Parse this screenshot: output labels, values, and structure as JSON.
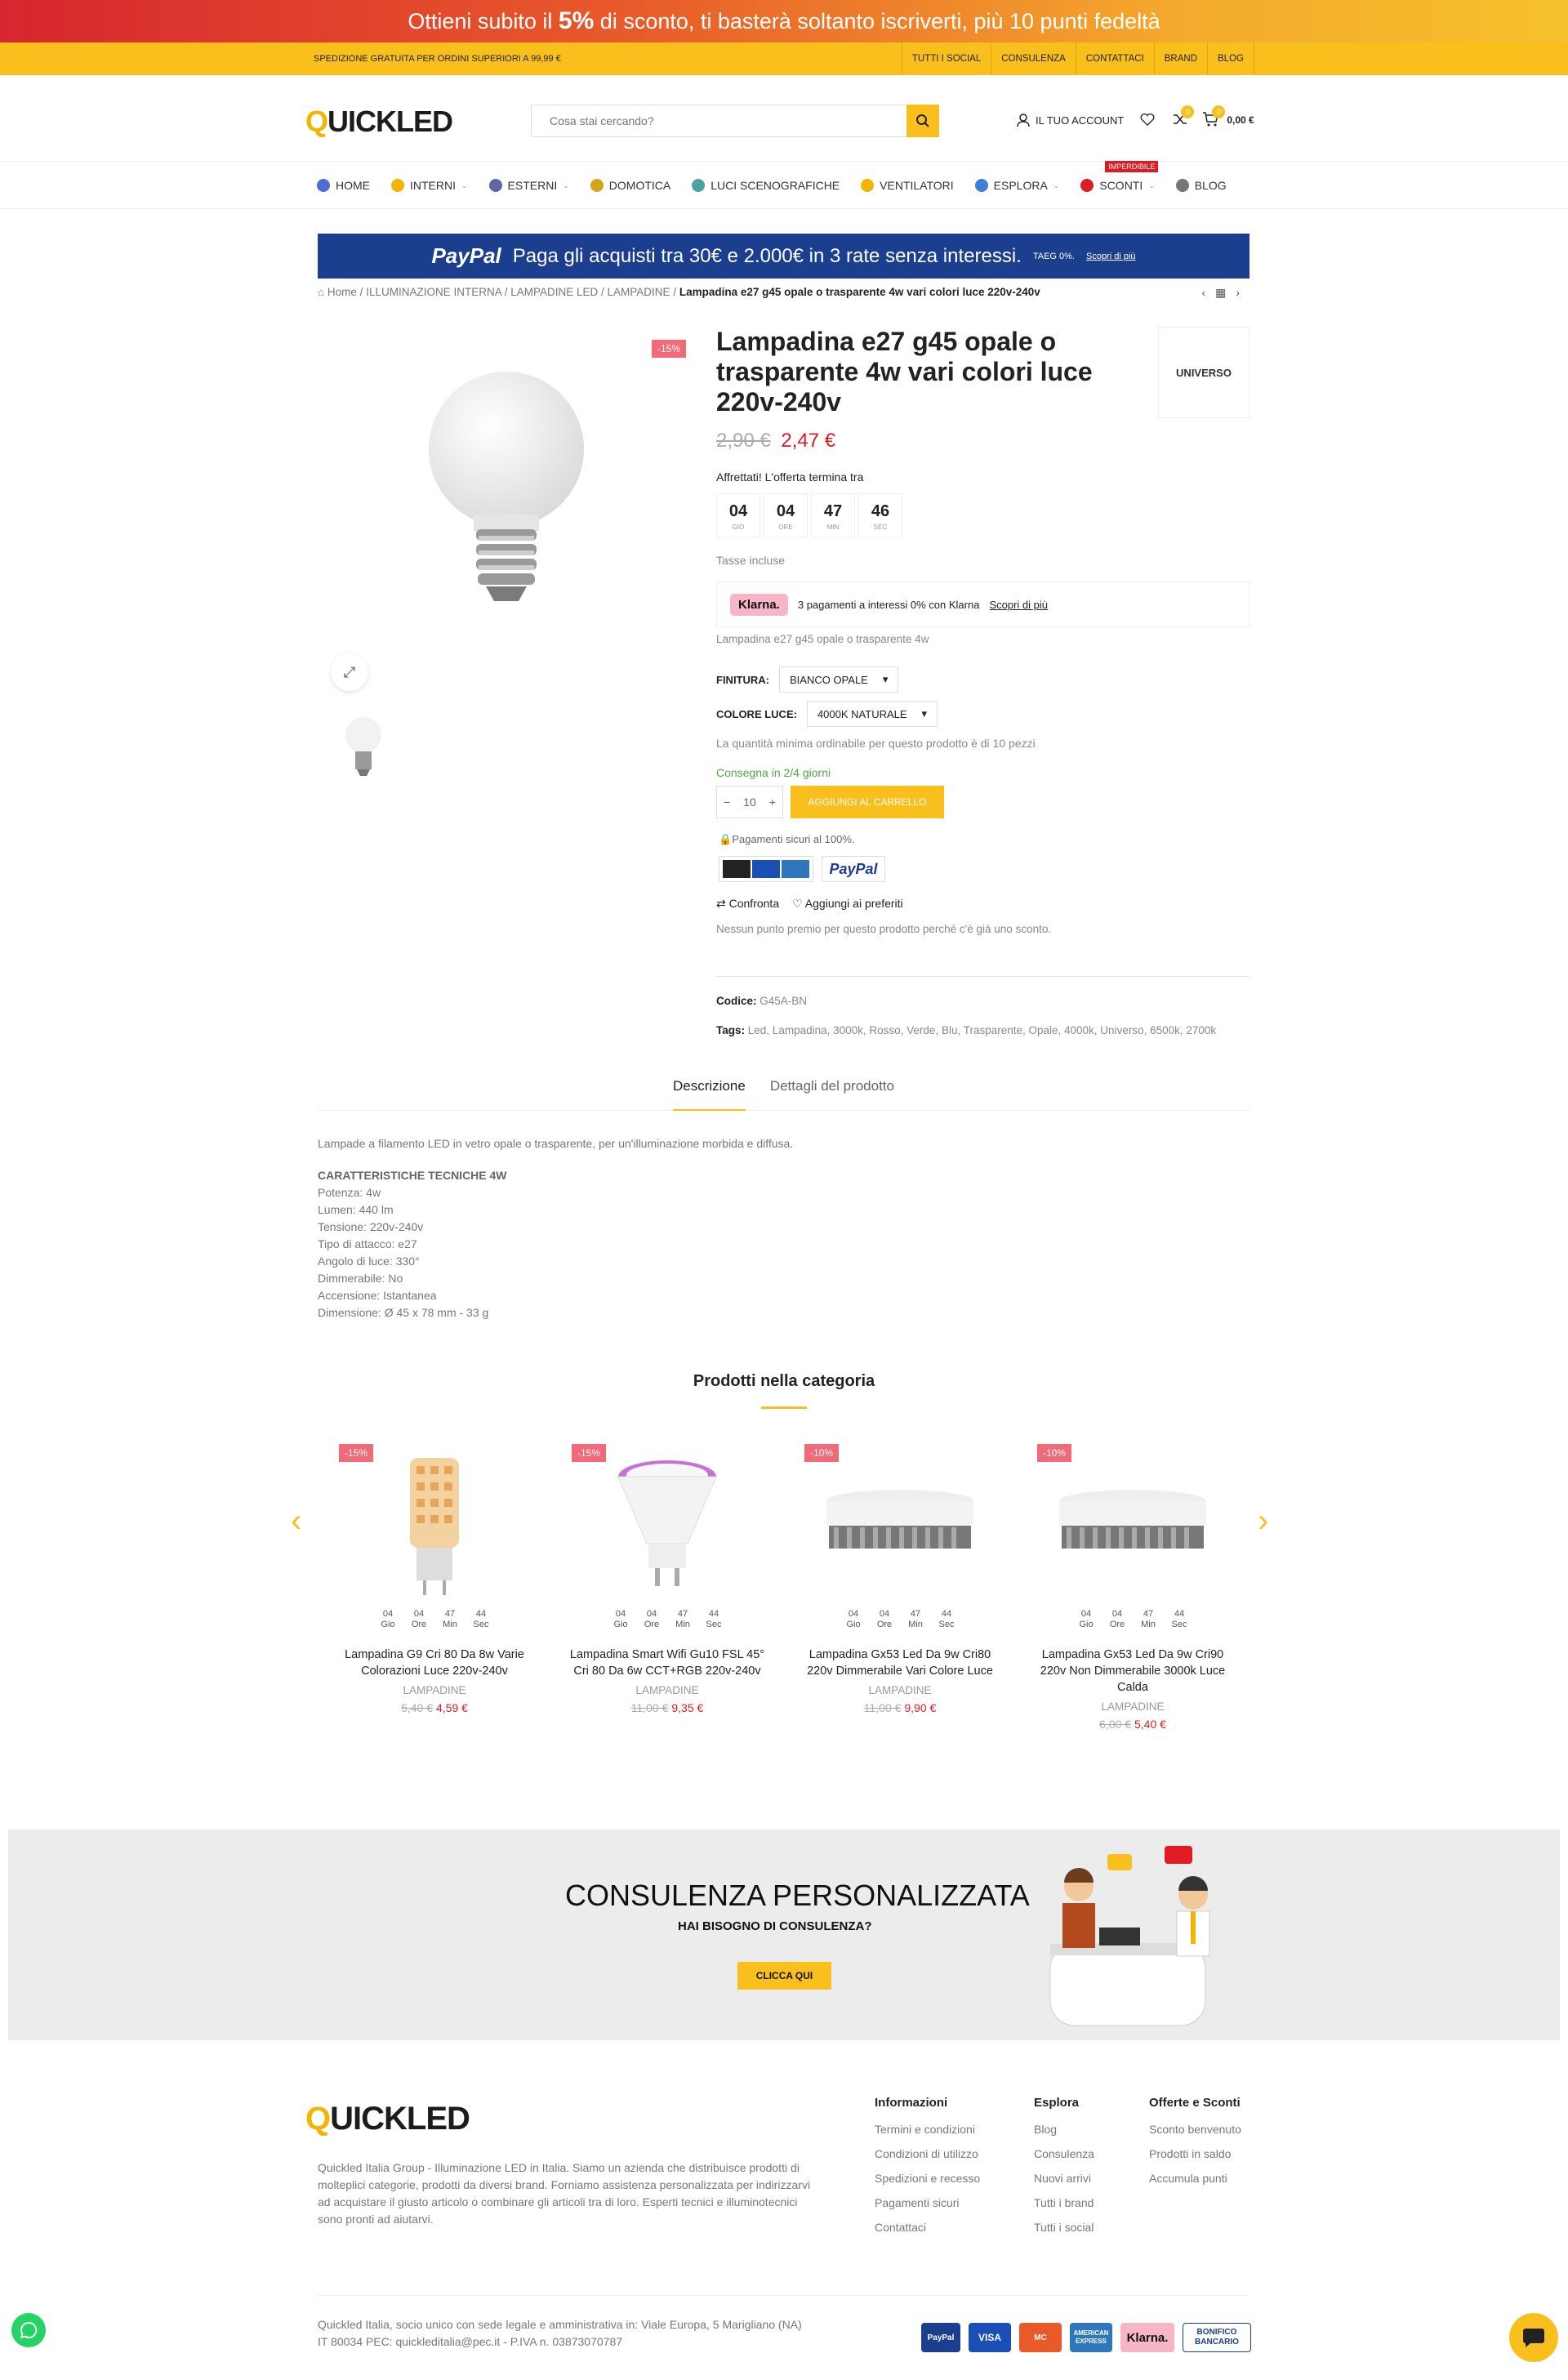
{
  "promo_banner": {
    "text_before": "Ottieni subito il",
    "percent": "5%",
    "text_after": "di sconto, ti basterà soltanto iscriverti, più 10 punti fedeltà"
  },
  "topbar": {
    "shipping": "SPEDIZIONE GRATUITA PER ORDINI SUPERIORI A 99,99 €",
    "links": [
      "TUTTI I SOCIAL",
      "CONSULENZA",
      "CONTATTACI",
      "BRAND",
      "BLOG"
    ]
  },
  "header": {
    "logo_q": "Q",
    "logo_rest": "UICKLED",
    "search_placeholder": "Cosa stai cercando?",
    "account_label": "IL TUO ACCOUNT",
    "wishlist_count": "0",
    "compare_count": "0",
    "cart_total": "0,00 €",
    "cart_count": "0"
  },
  "nav": {
    "items": [
      {
        "label": "HOME",
        "color": "#4a6fd1"
      },
      {
        "label": "INTERNI",
        "color": "#f3b500",
        "caret": "⌄"
      },
      {
        "label": "ESTERNI",
        "color": "#5a68a8",
        "caret": "⌄"
      },
      {
        "label": "DOMOTICA",
        "color": "#d9a21b"
      },
      {
        "label": "LUCI SCENOGRAFICHE",
        "color": "#4aa3a0"
      },
      {
        "label": "VENTILATORI",
        "color": "#f3b500"
      },
      {
        "label": "ESPLORA",
        "color": "#3f7fd8",
        "caret": "⌄"
      },
      {
        "label": "SCONTI",
        "color": "#e01b24",
        "caret": "⌄",
        "hot": "IMPERDIBILE"
      },
      {
        "label": "BLOG",
        "color": "#777"
      }
    ]
  },
  "paypal_banner": {
    "logo": "PayPal",
    "text": "Paga gli acquisti tra 30€ e 2.000€ in 3 rate senza interessi.",
    "small": "TAEG 0%.",
    "link": "Scopri di più"
  },
  "breadcrumb": {
    "home": "Home",
    "items": [
      "ILLUMINAZIONE INTERNA",
      "LAMPADINE LED",
      "LAMPADINE"
    ],
    "current": "Lampadina e27 g45 opale o trasparente 4w vari colori luce 220v-240v"
  },
  "product": {
    "sale_tag": "-15%",
    "title": "Lampadina e27 g45 opale o trasparente 4w vari colori luce 220v-240v",
    "brand": "UNIVERSO",
    "old_price": "2,90 €",
    "price": "2,47 €",
    "hurry": "Affrettati! L'offerta termina tra",
    "countdown": [
      {
        "n": "04",
        "l": "GIO"
      },
      {
        "n": "04",
        "l": "ORE"
      },
      {
        "n": "47",
        "l": "MIN"
      },
      {
        "n": "46",
        "l": "SEC"
      }
    ],
    "tax": "Tasse incluse",
    "klarna_logo": "Klarna.",
    "klarna_text": "3 pagamenti a interessi 0% con Klarna",
    "klarna_link": "Scopri di più",
    "short_desc": "Lampadina e27 g45 opale o trasparente 4w",
    "finish_label": "FINITURA:",
    "finish_value": "BIANCO OPALE",
    "color_label": "COLORE LUCE:",
    "color_value": "4000K NATURALE",
    "min_qty": "La quantità minima ordinabile per questo prodotto è di 10 pezzi",
    "delivery": "Consegna in 2/4 giorni",
    "qty": "10",
    "add_to_cart": "AGGIUNGI AL CARRELLO",
    "secure": "Pagamenti sicuri al 100%.",
    "paypal": "PayPal",
    "compare": "Confronta",
    "wishlist": "Aggiungi ai preferiti",
    "no_points": "Nessun punto premio per questo prodotto perché c'è già uno sconto.",
    "sku_label": "Codice:",
    "sku": "G45A-BN",
    "tags_label": "Tags:",
    "tags": "Led, Lampadina, 3000k, Rosso, Verde, Blu, Trasparente, Opale, 4000k, Universo, 6500k, 2700k"
  },
  "tabs": [
    "Descrizione",
    "Dettagli del prodotto"
  ],
  "description": {
    "intro": "Lampade a filamento LED in vetro opale o trasparente, per un'illuminazione morbida e diffusa.",
    "heading": "CARATTERISTICHE TECNICHE 4W",
    "specs": [
      "Potenza: 4w",
      "Lumen: 440 lm",
      "Tensione: 220v-240v",
      "Tipo di attacco: e27",
      "Angolo di luce: 330°",
      "Dimmerabile: No",
      "Accensione: Istantanea",
      "Dimensione: Ø 45 x 78 mm - 33 g"
    ]
  },
  "related": {
    "title": "Prodotti nella categoria",
    "countdown_labels": [
      "Gio",
      "Ore",
      "Min",
      "Sec"
    ],
    "countdown_values": [
      "04",
      "04",
      "47",
      "44"
    ],
    "items": [
      {
        "tag": "-15%",
        "name": "Lampadina G9 Cri 80 Da 8w Varie Colorazioni Luce 220v-240v",
        "cat": "LAMPADINE",
        "old": "5,40 €",
        "new": "4,59 €"
      },
      {
        "tag": "-15%",
        "name": "Lampadina Smart Wifi Gu10 FSL 45° Cri 80 Da 6w CCT+RGB 220v-240v",
        "cat": "LAMPADINE",
        "old": "11,00 €",
        "new": "9,35 €"
      },
      {
        "tag": "-10%",
        "name": "Lampadina Gx53 Led Da 9w Cri80 220v Dimmerabile Vari Colore Luce",
        "cat": "LAMPADINE",
        "old": "11,00 €",
        "new": "9,90 €"
      },
      {
        "tag": "-10%",
        "name": "Lampadina Gx53 Led Da 9w Cri90 220v Non Dimmerabile 3000k Luce Calda",
        "cat": "LAMPADINE",
        "old": "6,00 €",
        "new": "5,40 €"
      }
    ]
  },
  "consult": {
    "title": "CONSULENZA PERSONALIZZATA",
    "subtitle": "HAI BISOGNO DI CONSULENZA?",
    "button": "CLICCA QUI"
  },
  "footer": {
    "about": "Quickled Italia Group - Illuminazione LED in Italia. Siamo un azienda che distribuisce prodotti di molteplici categorie, prodotti da diversi brand. Forniamo assistenza personalizzata per indirizzarvi ad acquistare il giusto articolo o combinare gli articoli tra di loro. Esperti tecnici e illuminotecnici sono pronti ad aiutarvi.",
    "cols": [
      {
        "title": "Informazioni",
        "items": [
          "Termini e condizioni",
          "Condizioni di utilizzo",
          "Spedizioni e recesso",
          "Pagamenti sicuri",
          "Contattaci"
        ]
      },
      {
        "title": "Esplora",
        "items": [
          "Blog",
          "Consulenza",
          "Nuovi arrivi",
          "Tutti i brand",
          "Tutti i social"
        ]
      },
      {
        "title": "Offerte e Sconti",
        "items": [
          "Sconto benvenuto",
          "Prodotti in saldo",
          "Accumula punti"
        ]
      }
    ],
    "legal": "Quickled Italia, socio unico con sede legale e amministrativa in: Viale Europa, 5 Marigliano (NA) IT 80034 PEC: quickleditalia@pec.it - P.IVA n. 03873070787",
    "payments": [
      {
        "label": "PayPal",
        "color": "#1b3e8f"
      },
      {
        "label": "VISA",
        "color": "#1a4fb8"
      },
      {
        "label": "MC",
        "color": "#e85a2a"
      },
      {
        "label": "AMERICAN EXPRESS",
        "color": "#2e77bc"
      },
      {
        "label": "Klarna.",
        "color": "#f6b6c8"
      },
      {
        "label": "BONIFICO BANCARIO",
        "color": "#1b3e8f"
      }
    ]
  }
}
